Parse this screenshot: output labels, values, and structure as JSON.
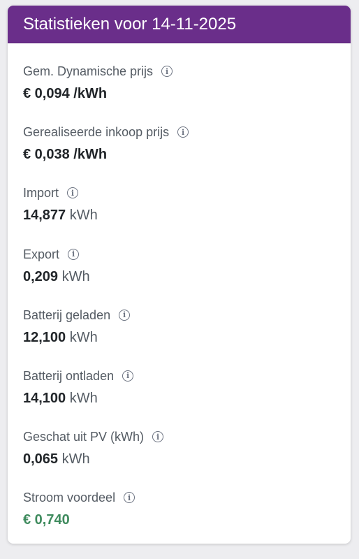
{
  "header": {
    "title": "Statistieken voor 14-11-2025",
    "background_color": "#6a2e8a"
  },
  "stats": [
    {
      "label": "Gem. Dynamische prijs",
      "value": "€ 0,094",
      "unit": "/kWh"
    },
    {
      "label": "Gerealiseerde inkoop prijs",
      "value": "€ 0,038",
      "unit": "/kWh"
    },
    {
      "label": "Import",
      "value": "14,877",
      "unit": "kWh"
    },
    {
      "label": "Export",
      "value": "0,209",
      "unit": "kWh"
    },
    {
      "label": "Batterij geladen",
      "value": "12,100",
      "unit": "kWh"
    },
    {
      "label": "Batterij ontladen",
      "value": "14,100",
      "unit": "kWh"
    },
    {
      "label": "Geschat uit PV (kWh)",
      "value": "0,065",
      "unit": "kWh"
    },
    {
      "label": "Stroom voordeel",
      "value": "€ 0,740",
      "unit": ""
    }
  ],
  "info_icon": "info-circle-icon",
  "positive_color": "#3f8b5e"
}
